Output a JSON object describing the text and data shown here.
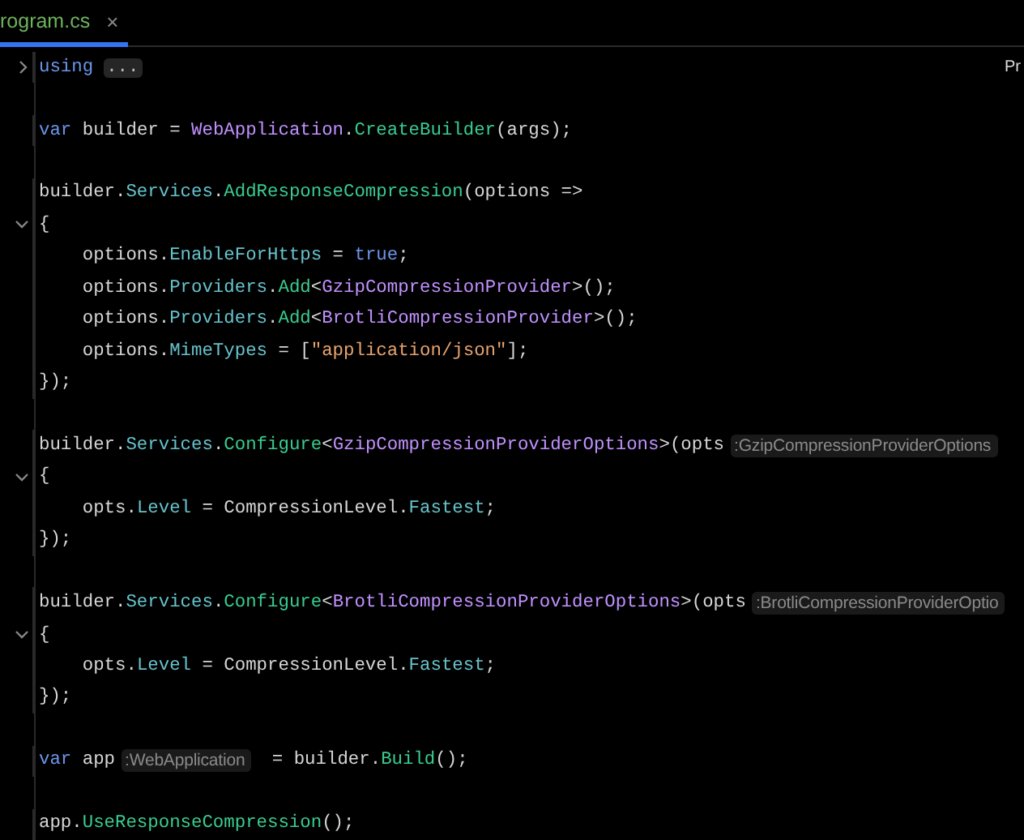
{
  "tab": {
    "label": "rogram.cs",
    "close": "×",
    "selected": true
  },
  "corner_text": "Pr",
  "lines": [
    {
      "collapsed": true,
      "gap_after": true,
      "tokens": [
        {
          "kind": "keyword",
          "text": "using"
        },
        {
          "kind": "folded",
          "text": "..."
        }
      ]
    },
    {
      "gap_after": true,
      "tokens": [
        {
          "kind": "keyword",
          "text": "var"
        },
        {
          "kind": "plain",
          "text": " builder = "
        },
        {
          "kind": "type",
          "text": "WebApplication"
        },
        {
          "kind": "plain",
          "text": "."
        },
        {
          "kind": "method",
          "text": "CreateBuilder"
        },
        {
          "kind": "plain",
          "text": "(args);"
        }
      ]
    },
    {
      "tokens": [
        {
          "kind": "plain",
          "text": "builder."
        },
        {
          "kind": "member",
          "text": "Services"
        },
        {
          "kind": "plain",
          "text": "."
        },
        {
          "kind": "method",
          "text": "AddResponseCompression"
        },
        {
          "kind": "plain",
          "text": "(options =>"
        }
      ]
    },
    {
      "collapsed": false,
      "tokens": [
        {
          "kind": "plain",
          "text": "{"
        }
      ]
    },
    {
      "tokens": [
        {
          "kind": "plain",
          "text": "    options."
        },
        {
          "kind": "member",
          "text": "EnableForHttps"
        },
        {
          "kind": "plain",
          "text": " = "
        },
        {
          "kind": "keyword",
          "text": "true"
        },
        {
          "kind": "plain",
          "text": ";"
        }
      ]
    },
    {
      "tokens": [
        {
          "kind": "plain",
          "text": "    options."
        },
        {
          "kind": "member",
          "text": "Providers"
        },
        {
          "kind": "plain",
          "text": "."
        },
        {
          "kind": "method",
          "text": "Add"
        },
        {
          "kind": "plain",
          "text": "<"
        },
        {
          "kind": "type",
          "text": "GzipCompressionProvider"
        },
        {
          "kind": "plain",
          "text": ">();"
        }
      ]
    },
    {
      "tokens": [
        {
          "kind": "plain",
          "text": "    options."
        },
        {
          "kind": "member",
          "text": "Providers"
        },
        {
          "kind": "plain",
          "text": "."
        },
        {
          "kind": "method",
          "text": "Add"
        },
        {
          "kind": "plain",
          "text": "<"
        },
        {
          "kind": "type",
          "text": "BrotliCompressionProvider"
        },
        {
          "kind": "plain",
          "text": ">();"
        }
      ]
    },
    {
      "tokens": [
        {
          "kind": "plain",
          "text": "    options."
        },
        {
          "kind": "member",
          "text": "MimeTypes"
        },
        {
          "kind": "plain",
          "text": " = ["
        },
        {
          "kind": "string",
          "text": "\"application/json\""
        },
        {
          "kind": "plain",
          "text": "];"
        }
      ]
    },
    {
      "gap_after": true,
      "tokens": [
        {
          "kind": "plain",
          "text": "});"
        }
      ]
    },
    {
      "tokens": [
        {
          "kind": "plain",
          "text": "builder."
        },
        {
          "kind": "member",
          "text": "Services"
        },
        {
          "kind": "plain",
          "text": "."
        },
        {
          "kind": "method",
          "text": "Configure"
        },
        {
          "kind": "plain",
          "text": "<"
        },
        {
          "kind": "type",
          "text": "GzipCompressionProviderOptions"
        },
        {
          "kind": "plain",
          "text": ">(opts"
        },
        {
          "kind": "hint",
          "text": ":GzipCompressionProviderOptions"
        }
      ]
    },
    {
      "collapsed": false,
      "tokens": [
        {
          "kind": "plain",
          "text": "{"
        }
      ]
    },
    {
      "tokens": [
        {
          "kind": "plain",
          "text": "    opts."
        },
        {
          "kind": "member",
          "text": "Level"
        },
        {
          "kind": "plain",
          "text": " = CompressionLevel."
        },
        {
          "kind": "constant",
          "text": "Fastest"
        },
        {
          "kind": "plain",
          "text": ";"
        }
      ]
    },
    {
      "gap_after": true,
      "tokens": [
        {
          "kind": "plain",
          "text": "});"
        }
      ]
    },
    {
      "tokens": [
        {
          "kind": "plain",
          "text": "builder."
        },
        {
          "kind": "member",
          "text": "Services"
        },
        {
          "kind": "plain",
          "text": "."
        },
        {
          "kind": "method",
          "text": "Configure"
        },
        {
          "kind": "plain",
          "text": "<"
        },
        {
          "kind": "type",
          "text": "BrotliCompressionProviderOptions"
        },
        {
          "kind": "plain",
          "text": ">(opts"
        },
        {
          "kind": "hint",
          "text": ":BrotliCompressionProviderOptio"
        }
      ]
    },
    {
      "collapsed": false,
      "tokens": [
        {
          "kind": "plain",
          "text": "{"
        }
      ]
    },
    {
      "tokens": [
        {
          "kind": "plain",
          "text": "    opts."
        },
        {
          "kind": "member",
          "text": "Level"
        },
        {
          "kind": "plain",
          "text": " = CompressionLevel."
        },
        {
          "kind": "constant",
          "text": "Fastest"
        },
        {
          "kind": "plain",
          "text": ";"
        }
      ]
    },
    {
      "gap_after": true,
      "tokens": [
        {
          "kind": "plain",
          "text": "});"
        }
      ]
    },
    {
      "gap_after": true,
      "tokens": [
        {
          "kind": "keyword",
          "text": "var"
        },
        {
          "kind": "plain",
          "text": " app"
        },
        {
          "kind": "hint",
          "text": ":WebApplication"
        },
        {
          "kind": "plain",
          "text": " = builder."
        },
        {
          "kind": "method",
          "text": "Build"
        },
        {
          "kind": "plain",
          "text": "();"
        }
      ]
    },
    {
      "tokens": [
        {
          "kind": "plain",
          "text": "app."
        },
        {
          "kind": "method",
          "text": "UseResponseCompression"
        },
        {
          "kind": "plain",
          "text": "();"
        }
      ]
    }
  ]
}
